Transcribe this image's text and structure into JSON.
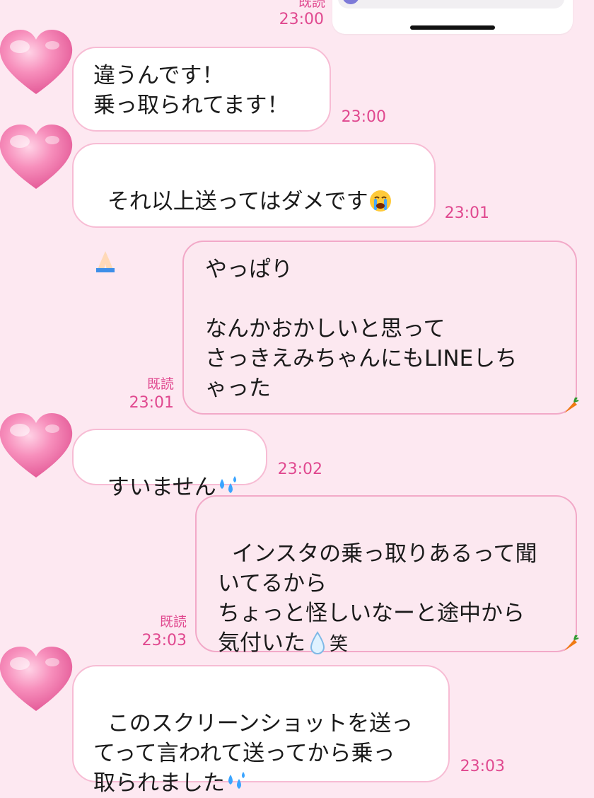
{
  "top": {
    "read_label": "既読",
    "time": "23:00"
  },
  "messages": [
    {
      "side": "left",
      "text": "違うんです！\n乗っ取られてます！",
      "time": "23:00"
    },
    {
      "side": "left",
      "text": "それ以上送ってはダメです",
      "text2": "",
      "time": "23:01"
    },
    {
      "side": "right",
      "text": "やっぱり\n\nなんかおかしいと思って\nさっきえみちゃんにもLINEしち\nゃった",
      "read": "既読",
      "time": "23:01"
    },
    {
      "side": "left",
      "text": "すいません",
      "time": "23:02"
    },
    {
      "side": "right",
      "text": "インスタの乗っ取りあるって聞\nいてるから\nちょっと怪しいなーと途中から\n気付いた",
      "suffix": "笑",
      "read": "既読",
      "time": "23:03"
    },
    {
      "side": "left",
      "text": "このスクリーンショットを送っ\nてって言われて送ってから乗っ\n取られました",
      "time": "23:03"
    }
  ],
  "icons": {
    "avatar": "pink-heart-icon",
    "crying": "loudly-crying-face-icon",
    "pray": "folded-hands-icon",
    "sweat": "sweat-droplets-icon",
    "drop": "droplet-icon",
    "carrot": "carrot-icon"
  },
  "colors": {
    "background": "#fde8f1",
    "timestamp": "#e0488f",
    "left_border": "#f7bcd4",
    "right_fill": "#fce8f0"
  }
}
